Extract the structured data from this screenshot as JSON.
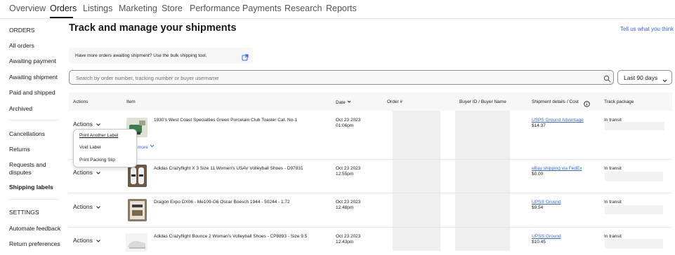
{
  "nav": {
    "tabs": [
      {
        "label": "Overview"
      },
      {
        "label": "Orders"
      },
      {
        "label": "Listings"
      },
      {
        "label": "Marketing"
      },
      {
        "label": "Store"
      },
      {
        "label": "Performance"
      },
      {
        "label": "Payments"
      },
      {
        "label": "Research"
      },
      {
        "label": "Reports"
      }
    ],
    "active_tab": "Orders"
  },
  "sidebar": {
    "orders_heading": "ORDERS",
    "items": [
      {
        "label": "All orders"
      },
      {
        "label": "Awaiting payment"
      },
      {
        "label": "Awaiting shipment"
      },
      {
        "label": "Paid and shipped"
      },
      {
        "label": "Archived"
      },
      {
        "label": "Cancellations"
      },
      {
        "label": "Returns"
      },
      {
        "label": "Requests and disputes"
      },
      {
        "label": "Shipping labels"
      }
    ],
    "settings_heading": "SETTINGS",
    "settings_items": [
      {
        "label": "Automate feedback"
      },
      {
        "label": "Return preferences"
      }
    ]
  },
  "main": {
    "title": "Track and manage your shipments",
    "feedback_link": "Tell us what you think",
    "banner_text": "Have more orders awaiting shipment? Use the bulk shipping tool.",
    "search_placeholder": "Search by order number, tracking number or buyer username",
    "date_range": "Last 90 days"
  },
  "table": {
    "headers": {
      "actions": "Actions",
      "item": "Item",
      "date": "Date",
      "order": "Order #",
      "buyer": "Buyer ID / Buyer Name",
      "shipment": "Shipment details / Cost",
      "track": "Track package"
    },
    "rows": [
      {
        "actions": "Actions",
        "item": "1930's West Coast Specialties Green Porcelain Club Toaster Cat. No-1",
        "date": "Oct 23 2023",
        "time": "01:06pm",
        "service": "USPS Ground Advantage",
        "cost": "$14.37",
        "status": "In transit"
      },
      {
        "actions": "Actions",
        "item": "Adidas Crazyflight X 3 Size 11 Women's USAV Volleyball Shoes - D97831",
        "date": "Oct 23 2023",
        "time": "12:55pm",
        "service": "eBay shipping via FedEx",
        "cost": "$0.00",
        "status": "In transit"
      },
      {
        "actions": "Actions",
        "item": "Dragon Expo DX06 - Me109-G6 Oscar Boesch 1944 - 50244 - 1:72",
        "date": "Oct 23 2023",
        "time": "12:48pm",
        "service": "UPS® Ground",
        "cost": "$9.54",
        "status": "In transit"
      },
      {
        "actions": "Actions",
        "item": "Adidas Crazyflight Bounce 2 Woman's Volleyball Shoes - CP8893 - Size 9.5",
        "date": "Oct 23 2023",
        "time": "12:43pm",
        "service": "UPS® Ground",
        "cost": "$10.45",
        "status": "In transit"
      }
    ],
    "show_more": "more"
  },
  "menu": {
    "items": [
      {
        "label": "Print Another Label"
      },
      {
        "label": "Void Label"
      },
      {
        "label": "Print Packing Slip"
      }
    ]
  },
  "colors": {
    "link": "#3665f3",
    "text": "#191919",
    "header_bg": "#f7f7f7"
  }
}
